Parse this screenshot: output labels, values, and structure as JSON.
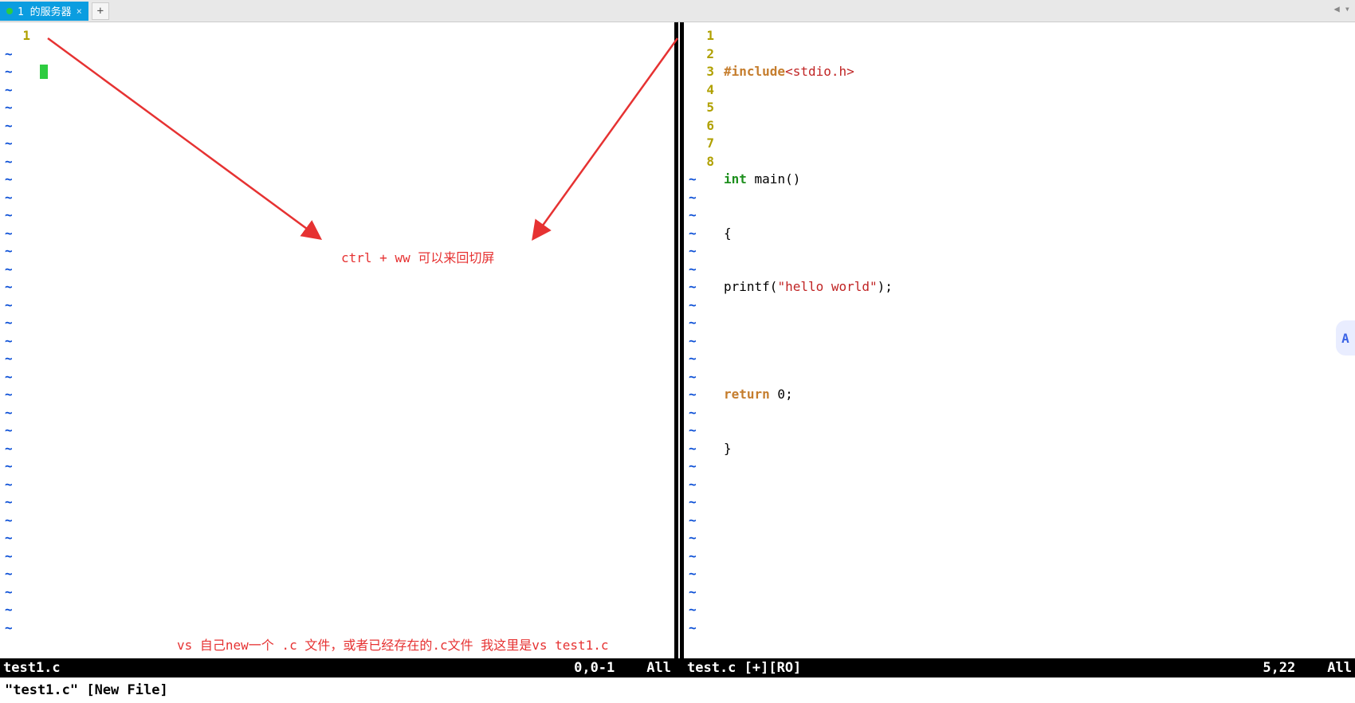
{
  "tabbar": {
    "tab_label": "1        的服务器",
    "tab_close": "×",
    "add_label": "+",
    "right_prev": "◀",
    "right_menu": "▾"
  },
  "left_pane": {
    "line_numbers": [
      "1"
    ],
    "tilde_rows": 33
  },
  "right_pane": {
    "line_numbers": [
      "1",
      "2",
      "3",
      "4",
      "5",
      "6",
      "7",
      "8"
    ],
    "tilde_rows": 26,
    "code": {
      "l1_pre": "#include",
      "l1_hdr": "<stdio.h>",
      "l3_kw": "int",
      "l3_rest": " main()",
      "l4": "{",
      "l5_pre": "printf(",
      "l5_str": "\"hello world\"",
      "l5_post": ");",
      "l7_kw": "return",
      "l7_rest": " 0;",
      "l8": "}"
    }
  },
  "statusbar": {
    "left_file": "test1.c",
    "left_pos": "0,0-1",
    "left_all": "All",
    "right_file": "test.c [+][RO]",
    "right_pos": "5,22",
    "right_all": "All"
  },
  "cmdline": "\"test1.c\" [New File]",
  "annotations": {
    "center_note": "ctrl + ww 可以来回切屏",
    "bottom_note": "vs  自己new一个 .c 文件，或者已经存在的.c文件     我这里是vs test1.c"
  },
  "side_badge": "A"
}
